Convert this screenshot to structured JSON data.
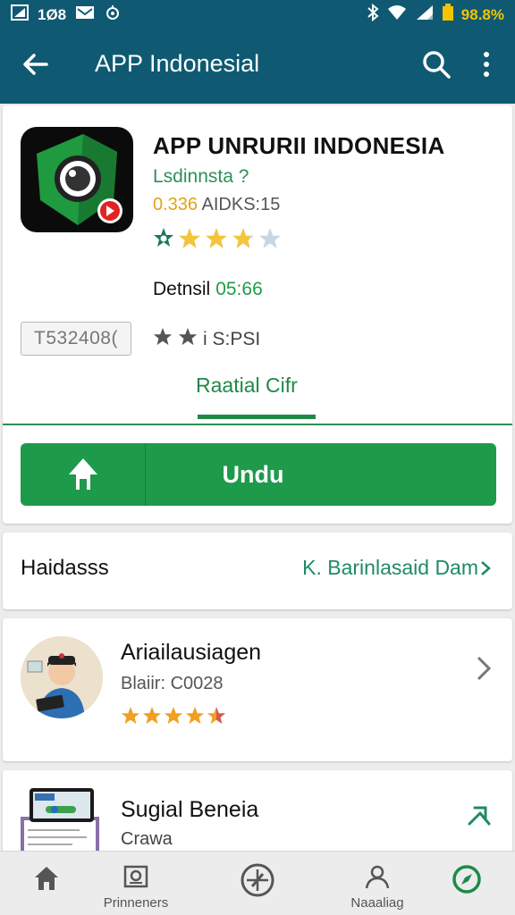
{
  "status_bar": {
    "left_text": "1Ø8",
    "battery_text": "98.8%"
  },
  "app_bar": {
    "title": "APP Indonesial"
  },
  "app": {
    "name": "APP UNRURII  INDONESIA",
    "developer": "Lsdinnsta ?",
    "meta_number": "0.336",
    "meta_rest": " AIDKS:15",
    "rating_fraction": 0.7,
    "detail_label": "Detnsil",
    "detail_value": "05:66",
    "code_value": "T532408(",
    "small_stars_text": "i  S:PSI",
    "tab_label": "Raatial Cifr",
    "install_label": "Undu"
  },
  "row": {
    "label": "Haidasss",
    "link": "K. Barinlasaid Dam"
  },
  "developer_card": {
    "title": "Ariailausiagen",
    "subtitle": "Blaiir: C0028",
    "stars": 4.5
  },
  "suggestion_card": {
    "title": "Sugial Beneia",
    "subtitle": "Crawa"
  },
  "bottom_nav": [
    {
      "label": "",
      "icon": "home-icon"
    },
    {
      "label": "Prinneners",
      "icon": "gallery-icon"
    },
    {
      "label": "",
      "icon": "compass-icon"
    },
    {
      "label": "Naaaliag",
      "icon": "person-icon"
    },
    {
      "label": "",
      "icon": "explore-icon"
    }
  ],
  "colors": {
    "app_bar": "#0f5a72",
    "accent_green": "#1e9a4b",
    "star_gold": "#f2c53d",
    "star_orange": "#f0a020"
  }
}
